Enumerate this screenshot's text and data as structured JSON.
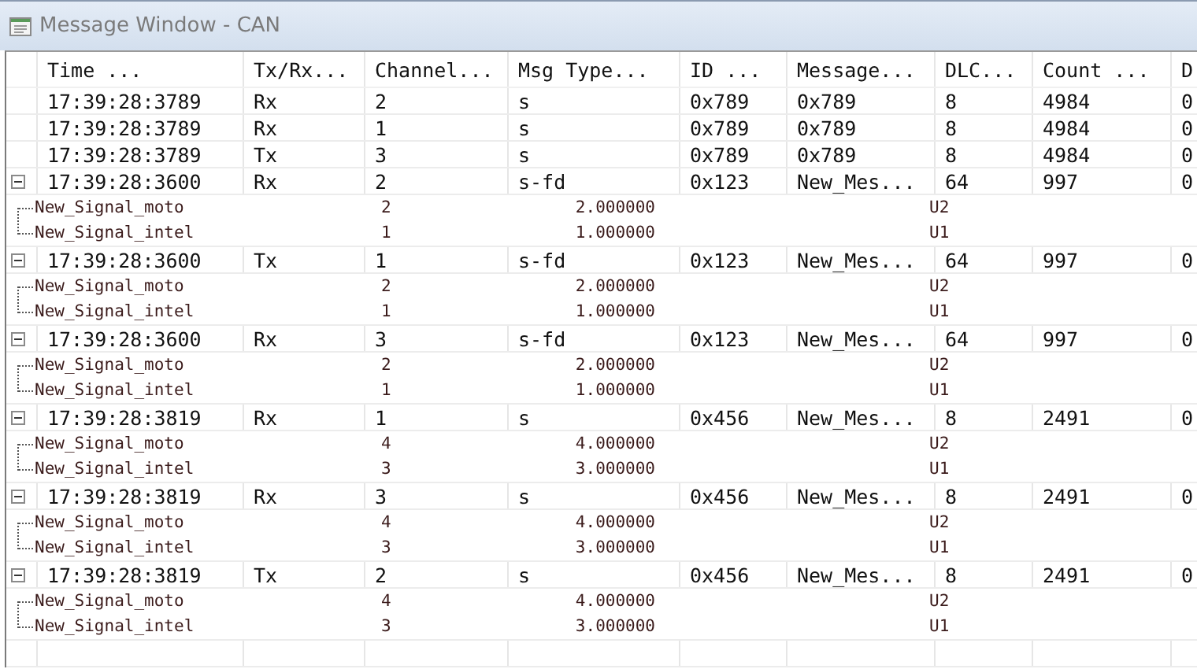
{
  "window": {
    "title": "Message Window - CAN"
  },
  "columns": [
    "Time ...",
    "Tx/Rx...",
    "Channel...",
    "Msg Type...",
    "ID ...",
    "Message...",
    "DLC...",
    "Count ...",
    "D"
  ],
  "messages": [
    {
      "time": "17:39:28:3789",
      "txrx": "Rx",
      "channel": "2",
      "msg_type": "s",
      "id": "0x789",
      "message": "0x789",
      "dlc": "8",
      "count": "4984",
      "column_9": "0"
    },
    {
      "time": "17:39:28:3789",
      "txrx": "Rx",
      "channel": "1",
      "msg_type": "s",
      "id": "0x789",
      "message": "0x789",
      "dlc": "8",
      "count": "4984",
      "column_9": "0"
    },
    {
      "time": "17:39:28:3789",
      "txrx": "Tx",
      "channel": "3",
      "msg_type": "s",
      "id": "0x789",
      "message": "0x789",
      "dlc": "8",
      "count": "4984",
      "column_9": "0"
    },
    {
      "expanded": true,
      "time": "17:39:28:3600",
      "txrx": "Rx",
      "channel": "2",
      "msg_type": "s-fd",
      "id": "0x123",
      "message": "New_Mes...",
      "dlc": "64",
      "count": "997",
      "column_9": "0",
      "signals": [
        {
          "name": "New_Signal_moto",
          "raw": "2",
          "value": "2.000000",
          "unit": "U2"
        },
        {
          "name": "New_Signal_intel",
          "raw": "1",
          "value": "1.000000",
          "unit": "U1"
        }
      ]
    },
    {
      "expanded": true,
      "time": "17:39:28:3600",
      "txrx": "Tx",
      "channel": "1",
      "msg_type": "s-fd",
      "id": "0x123",
      "message": "New_Mes...",
      "dlc": "64",
      "count": "997",
      "column_9": "0",
      "signals": [
        {
          "name": "New_Signal_moto",
          "raw": "2",
          "value": "2.000000",
          "unit": "U2"
        },
        {
          "name": "New_Signal_intel",
          "raw": "1",
          "value": "1.000000",
          "unit": "U1"
        }
      ]
    },
    {
      "expanded": true,
      "time": "17:39:28:3600",
      "txrx": "Rx",
      "channel": "3",
      "msg_type": "s-fd",
      "id": "0x123",
      "message": "New_Mes...",
      "dlc": "64",
      "count": "997",
      "column_9": "0",
      "signals": [
        {
          "name": "New_Signal_moto",
          "raw": "2",
          "value": "2.000000",
          "unit": "U2"
        },
        {
          "name": "New_Signal_intel",
          "raw": "1",
          "value": "1.000000",
          "unit": "U1"
        }
      ]
    },
    {
      "expanded": true,
      "time": "17:39:28:3819",
      "txrx": "Rx",
      "channel": "1",
      "msg_type": "s",
      "id": "0x456",
      "message": "New_Mes...",
      "dlc": "8",
      "count": "2491",
      "column_9": "0",
      "signals": [
        {
          "name": "New_Signal_moto",
          "raw": "4",
          "value": "4.000000",
          "unit": "U2"
        },
        {
          "name": "New_Signal_intel",
          "raw": "3",
          "value": "3.000000",
          "unit": "U1"
        }
      ]
    },
    {
      "expanded": true,
      "time": "17:39:28:3819",
      "txrx": "Rx",
      "channel": "3",
      "msg_type": "s",
      "id": "0x456",
      "message": "New_Mes...",
      "dlc": "8",
      "count": "2491",
      "column_9": "0",
      "signals": [
        {
          "name": "New_Signal_moto",
          "raw": "4",
          "value": "4.000000",
          "unit": "U2"
        },
        {
          "name": "New_Signal_intel",
          "raw": "3",
          "value": "3.000000",
          "unit": "U1"
        }
      ]
    },
    {
      "expanded": true,
      "time": "17:39:28:3819",
      "txrx": "Tx",
      "channel": "2",
      "msg_type": "s",
      "id": "0x456",
      "message": "New_Mes...",
      "dlc": "8",
      "count": "2491",
      "column_9": "0",
      "signals": [
        {
          "name": "New_Signal_moto",
          "raw": "4",
          "value": "4.000000",
          "unit": "U2"
        },
        {
          "name": "New_Signal_intel",
          "raw": "3",
          "value": "3.000000",
          "unit": "U1"
        }
      ]
    }
  ]
}
